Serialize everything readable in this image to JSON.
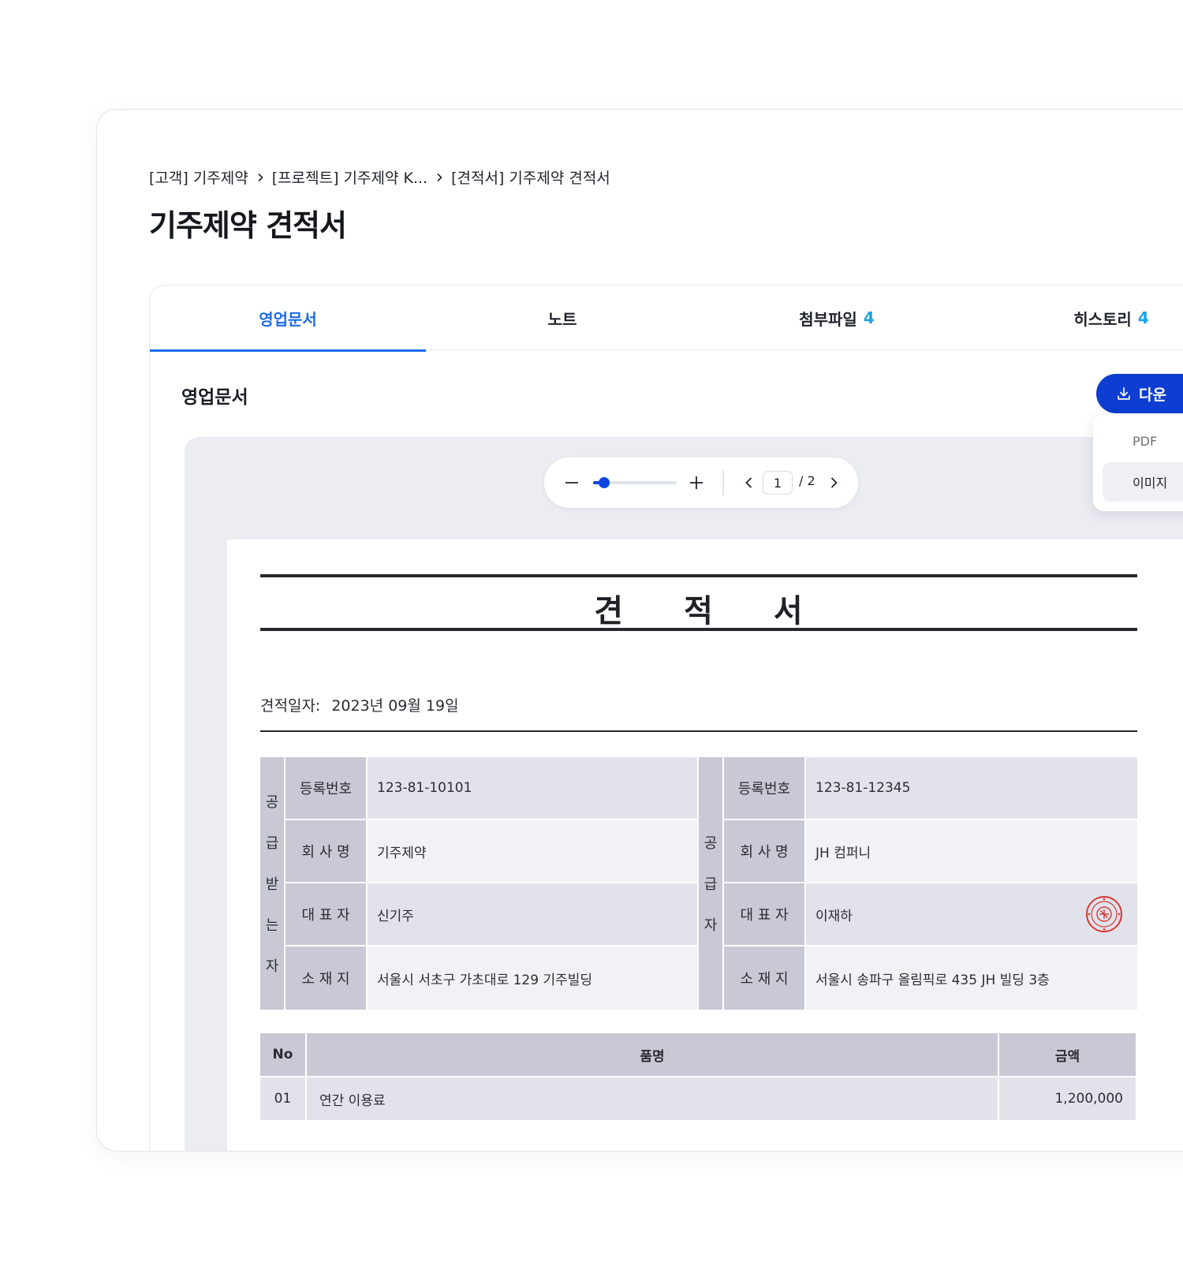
{
  "breadcrumb": {
    "items": [
      "[고객] 기주제약",
      "[프로젝트] 기주제약 K...",
      "[견적서] 기주제약 견적서"
    ]
  },
  "page_title": "기주제약 견적서",
  "tabs": [
    {
      "label": "영업문서",
      "count": ""
    },
    {
      "label": "노트",
      "count": ""
    },
    {
      "label": "첨부파일",
      "count": "4"
    },
    {
      "label": "히스토리",
      "count": "4"
    }
  ],
  "section_title": "영업문서",
  "download": {
    "label": "다운",
    "options": [
      "PDF",
      "이미지"
    ]
  },
  "viewer": {
    "zoom_fraction": 0.13,
    "current_page": "1",
    "page_total": "/ 2"
  },
  "document": {
    "title_chars": [
      "견",
      "적",
      "서"
    ],
    "date_label": "견적일자:",
    "date_value": "2023년 09월 19일",
    "receiver": {
      "vertical_label": [
        "공",
        "급",
        "받",
        "는",
        "자"
      ],
      "rows": [
        {
          "label": "등록번호",
          "value": "123-81-10101"
        },
        {
          "label": "회 사 명",
          "value": "기주제약"
        },
        {
          "label": "대 표 자",
          "value": "신기주"
        },
        {
          "label": "소 재 지",
          "value": "서울시 서초구 가초대로 129 기주빌딩"
        }
      ]
    },
    "supplier": {
      "vertical_label": [
        "공",
        "급",
        "자"
      ],
      "rows": [
        {
          "label": "등록번호",
          "value": "123-81-12345"
        },
        {
          "label": "회 사 명",
          "value": "JH 컴퍼니"
        },
        {
          "label": "대 표 자",
          "value": "이재하"
        },
        {
          "label": "소 재 지",
          "value": "서울시 송파구 올림픽로 435 JH 빌딩 3층"
        }
      ]
    },
    "items_table": {
      "headers": [
        "No",
        "품명",
        "금액"
      ],
      "rows": [
        {
          "no": "01",
          "name": "연간 이용료",
          "amount": "1,200,000"
        }
      ]
    }
  },
  "colors": {
    "accent": "#1c6ce8",
    "button": "#0d3ed1",
    "count": "#1aa3e8",
    "stamp": "#d33a3a"
  }
}
